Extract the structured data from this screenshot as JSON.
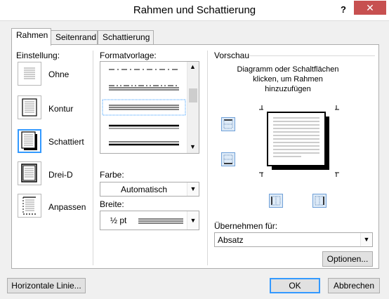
{
  "window": {
    "title": "Rahmen und Schattierung",
    "help": "?",
    "close": "✕"
  },
  "tabs": [
    {
      "label": "Rahmen",
      "active": true
    },
    {
      "label": "Seitenrand",
      "active": false
    },
    {
      "label": "Schattierung",
      "active": false
    }
  ],
  "settings": {
    "label": "Einstellung:",
    "items": [
      {
        "label": "Ohne"
      },
      {
        "label": "Kontur"
      },
      {
        "label": "Schattiert",
        "selected": true
      },
      {
        "label": "Drei-D"
      },
      {
        "label": "Anpassen"
      }
    ]
  },
  "style": {
    "label": "Formatvorlage:",
    "color_label": "Farbe:",
    "color_value": "Automatisch",
    "width_label": "Breite:",
    "width_value": "½ pt"
  },
  "preview": {
    "label": "Vorschau",
    "hint": "Diagramm oder Schaltflächen klicken, um Rahmen hinzuzufügen"
  },
  "apply": {
    "label": "Übernehmen für:",
    "value": "Absatz"
  },
  "buttons": {
    "options": "Optionen...",
    "horizontal_line": "Horizontale Linie...",
    "ok": "OK",
    "cancel": "Abbrechen"
  },
  "colors": {
    "selection": "#3399ff",
    "close_bg": "#c75050"
  }
}
